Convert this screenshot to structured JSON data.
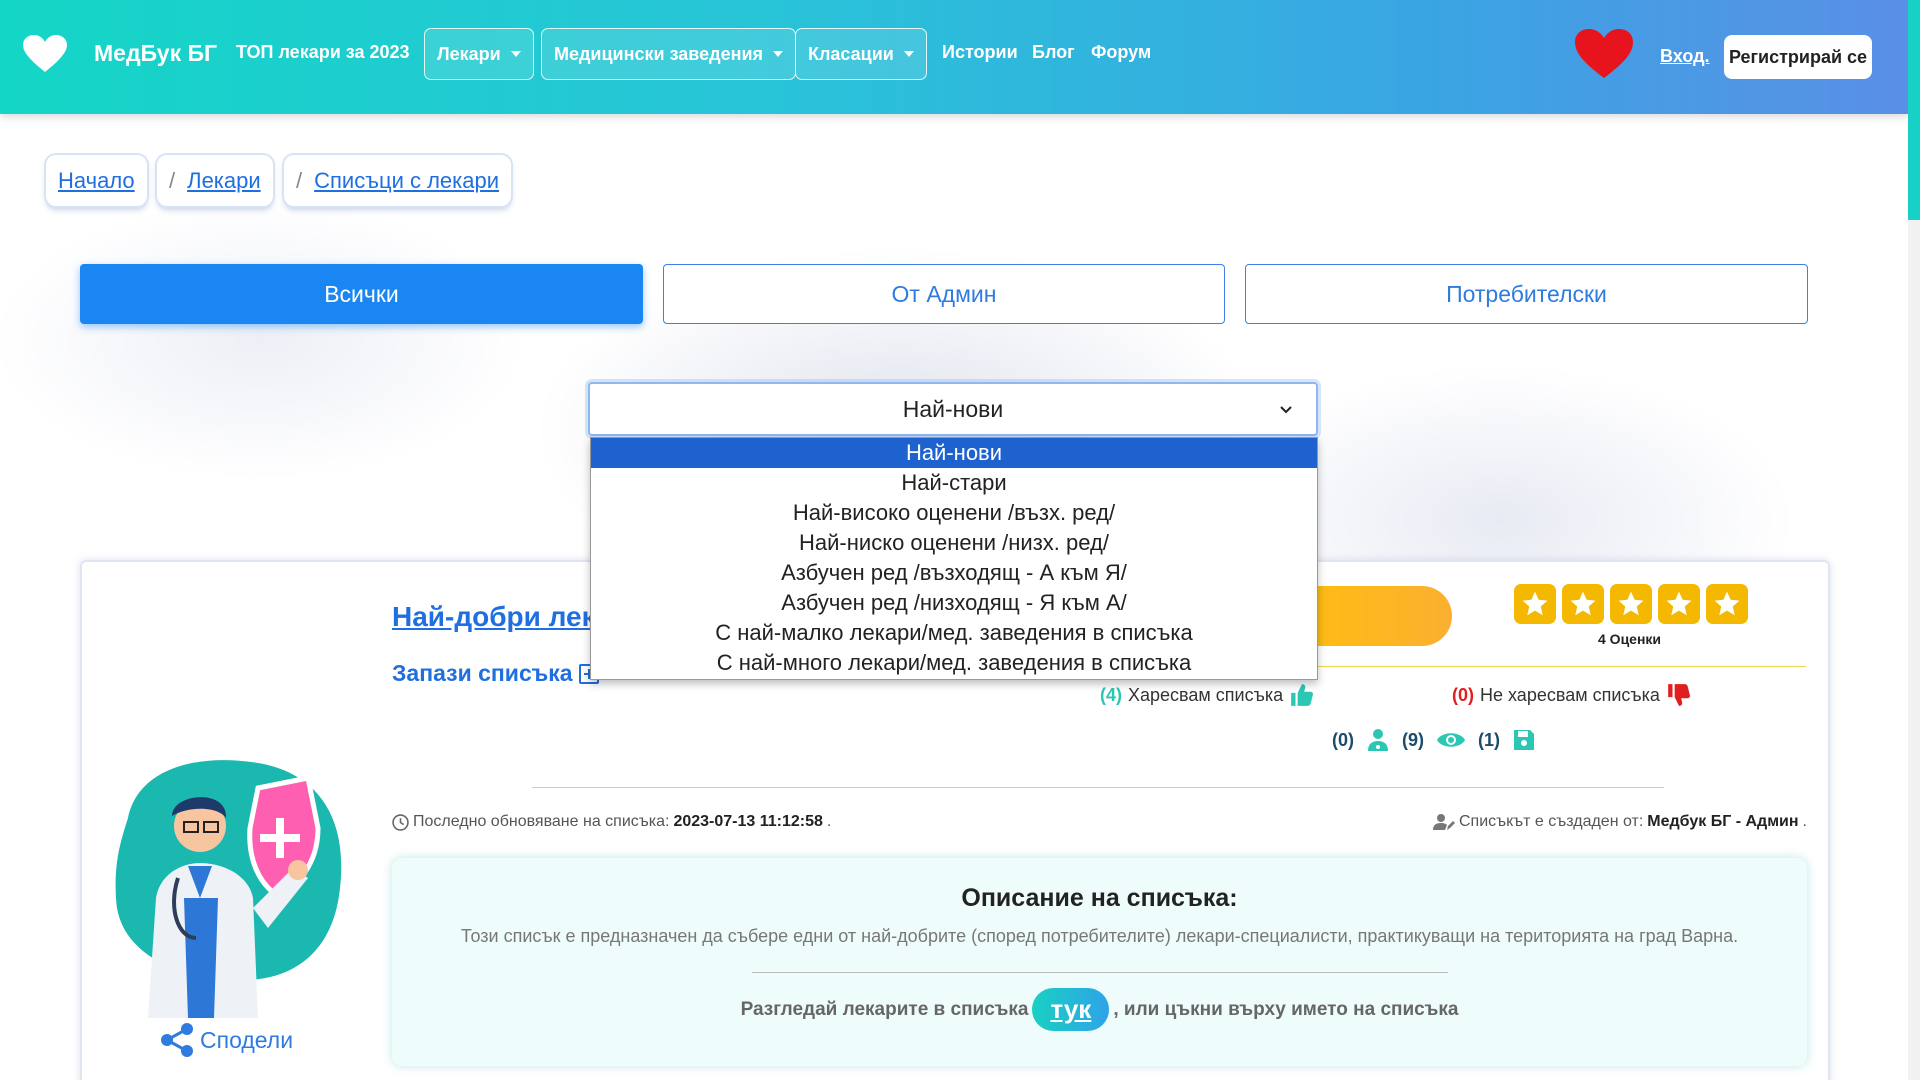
{
  "nav": {
    "brand": "МедБук БГ",
    "top_doctors": "ТОП лекари за 2023",
    "dropdowns": [
      "Лекари",
      "Медицински заведения",
      "Класации"
    ],
    "links": [
      "Истории",
      "Блог",
      "Форум"
    ],
    "login": "Вход.",
    "register": "Регистрирай се",
    "accent_color": "#17d1c6"
  },
  "breadcrumbs": {
    "home": "Начало",
    "doctors": "Лекари",
    "lists": "Списъци с лекари",
    "separator": "/"
  },
  "tabs": {
    "all": "Всички",
    "admin": "От Админ",
    "users": "Потребителски"
  },
  "sort": {
    "selected": "Най-нови",
    "options": [
      "Най-нови",
      "Най-стари",
      "Най-високо оценени /възх. ред/",
      "Най-ниско оценени /низх. ред/",
      "Азбучен ред /възходящ - А към Я/",
      "Азбучен ред /низходящ - Я към А/",
      "С най-малко лекари/мед. заведения в списъка",
      "С най-много лекари/мед. заведения в списъка"
    ]
  },
  "card": {
    "title": "Най-добри лека",
    "save_list": "Запази списъка",
    "ratings_count": "4 Оценки",
    "likes_count": "(4)",
    "likes_label": "Харесвам списъка",
    "dislikes_count": "(0)",
    "dislikes_label": "Не харесвам списъка",
    "stats": {
      "doctors": "(0)",
      "views": "(9)",
      "saves": "(1)"
    },
    "updated_label": "Последно обновяване на списъка:",
    "updated_value": "2023-07-13 11:12:58",
    "created_label": "Списъкът е създаден от:",
    "created_value": "Медбук БГ - Админ",
    "desc_title": "Описание на списъка:",
    "desc_text": "Този списък е предназначен да събере едни от най-добрите (според потребителите) лекари-специалисти, практикуващи на територията на град Варна.",
    "cta_before": "Разгледай лекарите в списъка",
    "cta_here": "тук",
    "cta_after": ", или цъкни върху името на списъка",
    "share": "Сподели"
  }
}
